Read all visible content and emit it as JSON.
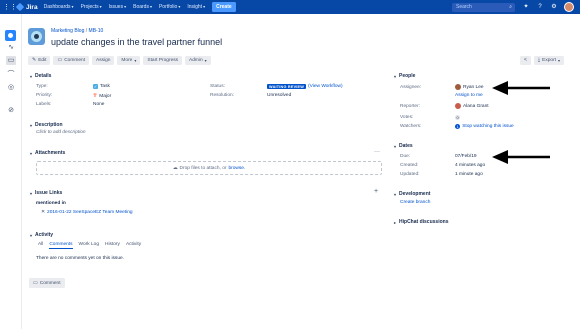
{
  "topnav": {
    "logo": "Jira",
    "items": [
      "Dashboards",
      "Projects",
      "Issues",
      "Boards",
      "Portfolio",
      "Insight"
    ],
    "create": "Create",
    "search_placeholder": "Search",
    "icons": [
      "megaphone-icon",
      "help-icon",
      "settings-icon",
      "avatar"
    ]
  },
  "breadcrumb": {
    "project": "Marketing Blog",
    "separator": "/",
    "key": "MB-10"
  },
  "issue": {
    "title": "update changes in the travel partner funnel"
  },
  "toolbar": {
    "edit": "Edit",
    "comment": "Comment",
    "assign": "Assign",
    "more": "More",
    "start_progress": "Start Progress",
    "admin": "Admin",
    "export": "Export"
  },
  "details": {
    "heading": "Details",
    "type_label": "Type:",
    "type_value": "Task",
    "priority_label": "Priority:",
    "priority_value": "Major",
    "labels_label": "Labels:",
    "labels_value": "None",
    "status_label": "Status:",
    "status_value": "WAITING REVIEW",
    "workflow_link": "(View Workflow)",
    "resolution_label": "Resolution:",
    "resolution_value": "Unresolved"
  },
  "description": {
    "heading": "Description",
    "placeholder": "Click to add description"
  },
  "attachments": {
    "heading": "Attachments",
    "drop_text": "Drop files to attach, or",
    "browse": "browse."
  },
  "issue_links": {
    "heading": "Issue Links",
    "relation": "mentioned in",
    "linked_item": "2016-01-22 SeeSpaceEZ Team Meeting"
  },
  "activity": {
    "heading": "Activity",
    "tabs": [
      "All",
      "Comments",
      "Work Log",
      "History",
      "Activity"
    ],
    "active_tab": "Comments",
    "empty": "There are no comments yet on this issue.",
    "comment_button": "Comment"
  },
  "people": {
    "heading": "People",
    "assignee_label": "Assignee:",
    "assignee": "Ryan Lee",
    "assign_to_me": "Assign to me",
    "reporter_label": "Reporter:",
    "reporter": "Alana Grant",
    "votes_label": "Votes:",
    "votes": "0",
    "watchers_label": "Watchers:",
    "watchers_count": "1",
    "stop_watching": "Stop watching this issue"
  },
  "dates": {
    "heading": "Dates",
    "due_label": "Due:",
    "due": "07/Feb/19",
    "created_label": "Created:",
    "created": "4 minutes ago",
    "updated_label": "Updated:",
    "updated": "1 minute ago"
  },
  "development": {
    "heading": "Development",
    "create_branch": "Create branch"
  },
  "hipchat": {
    "heading": "HipChat discussions"
  },
  "colors": {
    "nav": "#0747a6",
    "link": "#0052cc",
    "text": "#172b4d",
    "create": "#4c9aff"
  }
}
